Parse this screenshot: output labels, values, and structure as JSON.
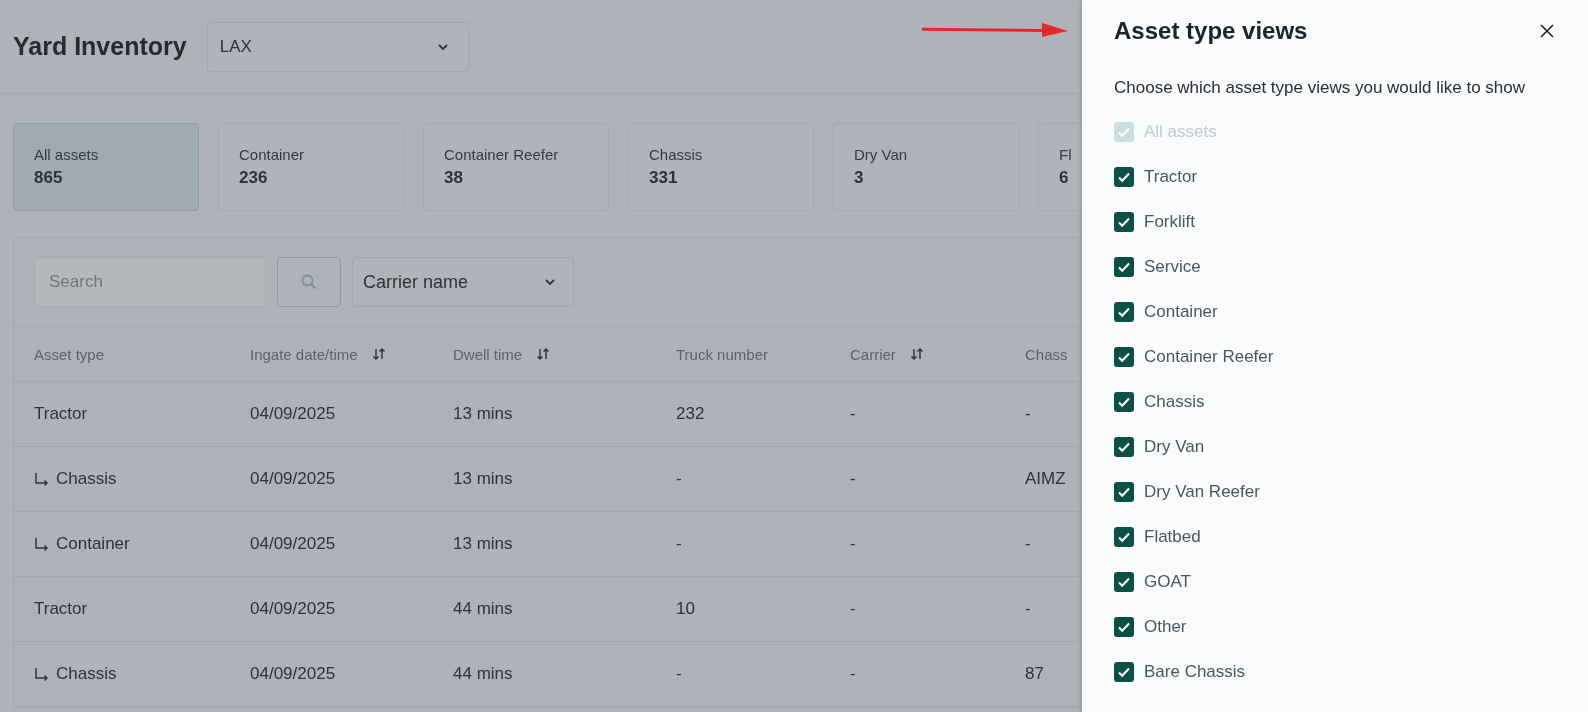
{
  "header": {
    "title": "Yard Inventory",
    "location": "LAX"
  },
  "cards": [
    {
      "label": "All assets",
      "count": "865",
      "selected": true
    },
    {
      "label": "Container",
      "count": "236",
      "selected": false
    },
    {
      "label": "Container Reefer",
      "count": "38",
      "selected": false
    },
    {
      "label": "Chassis",
      "count": "331",
      "selected": false
    },
    {
      "label": "Dry Van",
      "count": "3",
      "selected": false
    },
    {
      "label": "Fl",
      "count": "6",
      "selected": false
    }
  ],
  "filters": {
    "search_placeholder": "Search",
    "carrier": "Carrier name"
  },
  "table": {
    "columns": [
      {
        "label": "Asset type",
        "sortable": false
      },
      {
        "label": "Ingate date/time",
        "sortable": true
      },
      {
        "label": "Dwell time",
        "sortable": true
      },
      {
        "label": "Truck number",
        "sortable": false
      },
      {
        "label": "Carrier",
        "sortable": true
      },
      {
        "label": "Chass"
      }
    ],
    "rows": [
      {
        "cells": [
          "Tractor",
          "04/09/2025",
          "13 mins",
          "232",
          "-",
          "-"
        ],
        "children": [
          {
            "cells": [
              "Chassis",
              "04/09/2025",
              "13 mins",
              "-",
              "-",
              "AIMZ"
            ]
          },
          {
            "cells": [
              "Container",
              "04/09/2025",
              "13 mins",
              "-",
              "-",
              "-"
            ]
          }
        ]
      },
      {
        "cells": [
          "Tractor",
          "04/09/2025",
          "44 mins",
          "10",
          "-",
          "-"
        ],
        "children": [
          {
            "cells": [
              "Chassis",
              "04/09/2025",
              "44 mins",
              "-",
              "-",
              "87"
            ]
          }
        ]
      }
    ]
  },
  "panel": {
    "title": "Asset type views",
    "description": "Choose which asset type views you would like to show",
    "options": [
      {
        "label": "All assets",
        "checked": true,
        "disabled": true
      },
      {
        "label": "Tractor",
        "checked": true,
        "disabled": false
      },
      {
        "label": "Forklift",
        "checked": true,
        "disabled": false
      },
      {
        "label": "Service",
        "checked": true,
        "disabled": false
      },
      {
        "label": "Container",
        "checked": true,
        "disabled": false
      },
      {
        "label": "Container Reefer",
        "checked": true,
        "disabled": false
      },
      {
        "label": "Chassis",
        "checked": true,
        "disabled": false
      },
      {
        "label": "Dry Van",
        "checked": true,
        "disabled": false
      },
      {
        "label": "Dry Van Reefer",
        "checked": true,
        "disabled": false
      },
      {
        "label": "Flatbed",
        "checked": true,
        "disabled": false
      },
      {
        "label": "GOAT",
        "checked": true,
        "disabled": false
      },
      {
        "label": "Other",
        "checked": true,
        "disabled": false
      },
      {
        "label": "Bare Chassis",
        "checked": true,
        "disabled": false
      }
    ]
  }
}
